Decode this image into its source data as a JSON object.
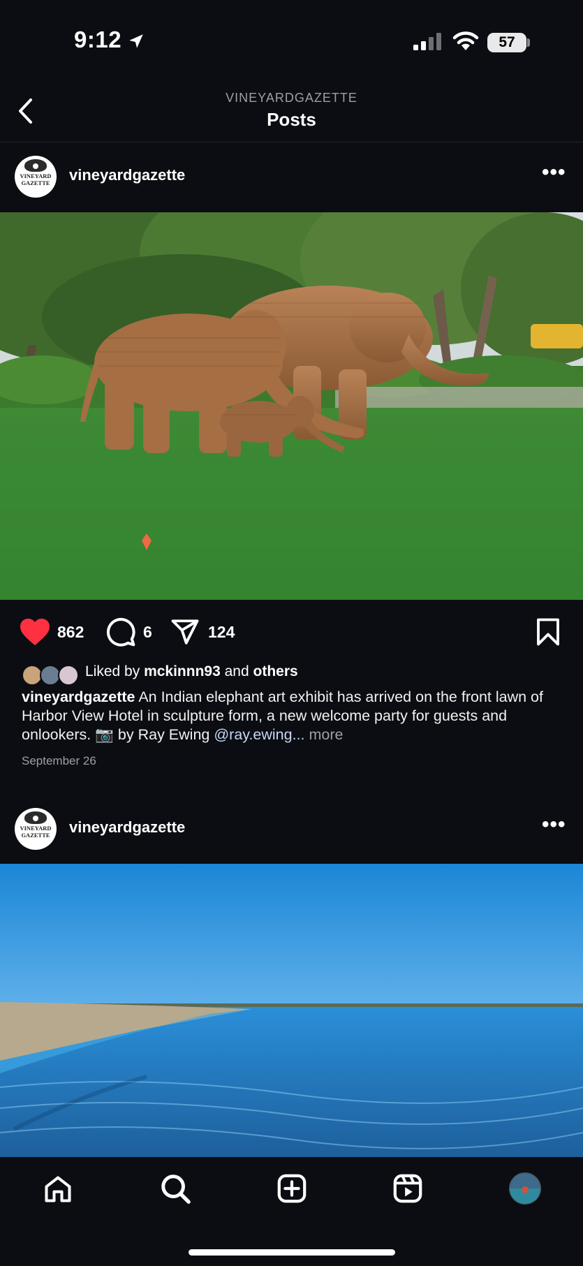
{
  "status_bar": {
    "time": "9:12",
    "battery": "57"
  },
  "header": {
    "account": "VINEYARDGAZETTE",
    "title": "Posts"
  },
  "posts": [
    {
      "username": "vineyardgazette",
      "avatar_text_line1": "VINEYARD",
      "avatar_text_line2": "GAZETTE",
      "likes": "862",
      "comments": "6",
      "shares": "124",
      "liked_by_prefix": "Liked by",
      "liked_by_user": "mckinnn93",
      "liked_by_and": "and",
      "liked_by_others": "others",
      "caption_user": "vineyardgazette",
      "caption_text": "An Indian elephant art exhibit has arrived on the front lawn of Harbor View Hotel in sculpture form, a new welcome party for guests and onlookers. 📷 by Ray Ewing",
      "caption_mention": "@ray.ewing",
      "caption_ellipsis": "...",
      "caption_more": "more",
      "date": "September 26"
    },
    {
      "username": "vineyardgazette",
      "avatar_text_line1": "VINEYARD",
      "avatar_text_line2": "GAZETTE"
    }
  ],
  "icons": {
    "back": "chevron-left-icon",
    "more": "more-horizontal-icon",
    "like": "heart-icon",
    "comment": "comment-icon",
    "share": "paper-plane-icon",
    "save": "bookmark-icon",
    "tabs": [
      "home-icon",
      "search-icon",
      "create-post-icon",
      "reels-icon",
      "profile-avatar"
    ]
  },
  "colors": {
    "background": "#0b0d12",
    "like_red": "#ff3040",
    "mention": "#c8d6f2"
  }
}
